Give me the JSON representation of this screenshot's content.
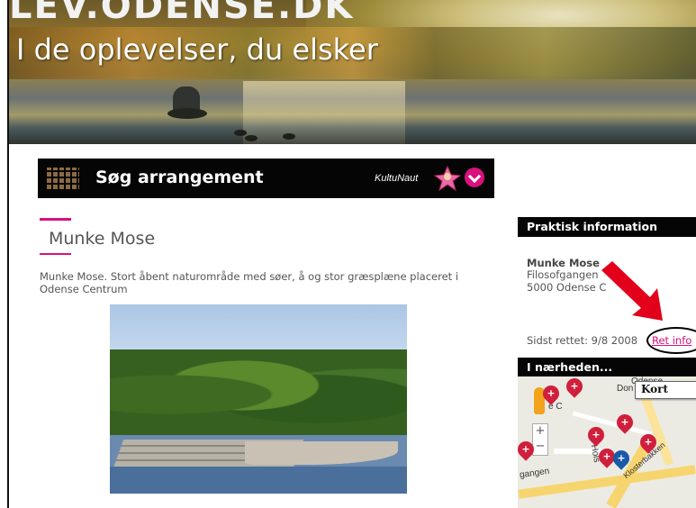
{
  "banner": {
    "brand": "LEV.ODENSE.DK",
    "tagline": "I de oplevelser, du elsker"
  },
  "search_bar": {
    "icon": "calendar-grid-icon",
    "title": "Søg arrangement",
    "partner": "KultuNaut",
    "expand_icon": "chevron-down-icon"
  },
  "main": {
    "title": "Munke Mose",
    "description": "Munke Mose. Stort åbent naturområde med søer, å og stor græsplæne placeret i Odense Centrum"
  },
  "sidebar": {
    "practical_heading": "Praktisk information",
    "venue_name": "Munke Mose",
    "address_line1": "Filosofgangen",
    "address_line2": "5000 Odense C",
    "updated_text": "Sidst rettet: 9/8 2008",
    "edit_link": "Ret info",
    "nearby_heading": "I nærheden...",
    "map": {
      "map_button": "Kort",
      "labels": [
        "Odense",
        "Don",
        "e C",
        "Hols",
        "gangen",
        "Klosterbakken"
      ],
      "zoom_in": "+",
      "zoom_out": "−"
    }
  },
  "colors": {
    "accent": "#d8117d",
    "header_bg": "#050505",
    "pin_red": "#d01f3c",
    "pin_blue": "#1a5aa8",
    "annotation_arrow": "#e2001a"
  }
}
